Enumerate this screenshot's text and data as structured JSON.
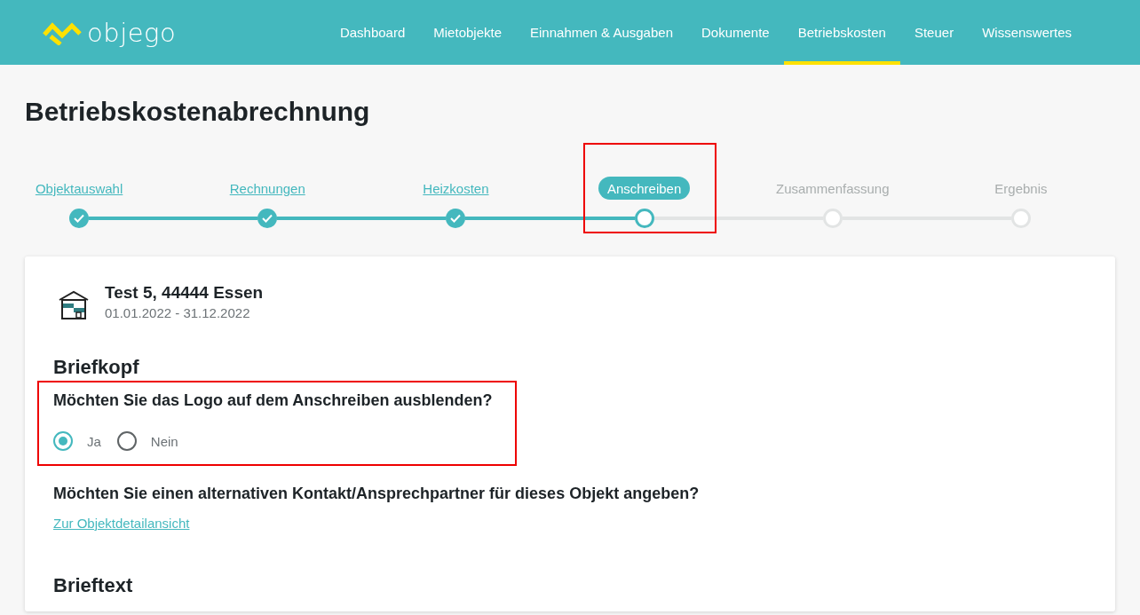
{
  "header": {
    "logo": "objego",
    "nav": [
      {
        "label": "Dashboard",
        "selected": false
      },
      {
        "label": "Mietobjekte",
        "selected": false
      },
      {
        "label": "Einnahmen & Ausgaben",
        "selected": false
      },
      {
        "label": "Dokumente",
        "selected": false
      },
      {
        "label": "Betriebskosten",
        "selected": true
      },
      {
        "label": "Steuer",
        "selected": false
      },
      {
        "label": "Wissenswertes",
        "selected": false
      }
    ]
  },
  "page_title": "Betriebskostenabrechnung",
  "steps": [
    {
      "label": "Objektauswahl",
      "kind": "done",
      "highlighted": false
    },
    {
      "label": "Rechnungen",
      "kind": "done",
      "highlighted": false
    },
    {
      "label": "Heizkosten",
      "kind": "done",
      "highlighted": false
    },
    {
      "label": "Anschreiben",
      "kind": "current",
      "highlighted": true
    },
    {
      "label": "Zusammenfassung",
      "kind": "pending",
      "highlighted": false
    },
    {
      "label": "Ergebnis",
      "kind": "pending",
      "highlighted": false
    }
  ],
  "card": {
    "property": {
      "address": "Test 5, 44444 Essen",
      "period": "01.01.2022 - 31.12.2022"
    },
    "sections": [
      {
        "heading": "Briefkopf",
        "questions": [
          {
            "text": "Möchten Sie das Logo auf dem Anschreiben ausblenden?",
            "highlighted": true,
            "options": [
              {
                "label": "Ja",
                "selected": true
              },
              {
                "label": "Nein",
                "selected": false
              }
            ]
          },
          {
            "text": "Möchten Sie einen alternativen Kontakt/Ansprechpartner für dieses Objekt angeben?",
            "highlighted": false,
            "link": "Zur Objektdetailansicht"
          }
        ]
      },
      {
        "heading": "Brieftext"
      }
    ]
  }
}
